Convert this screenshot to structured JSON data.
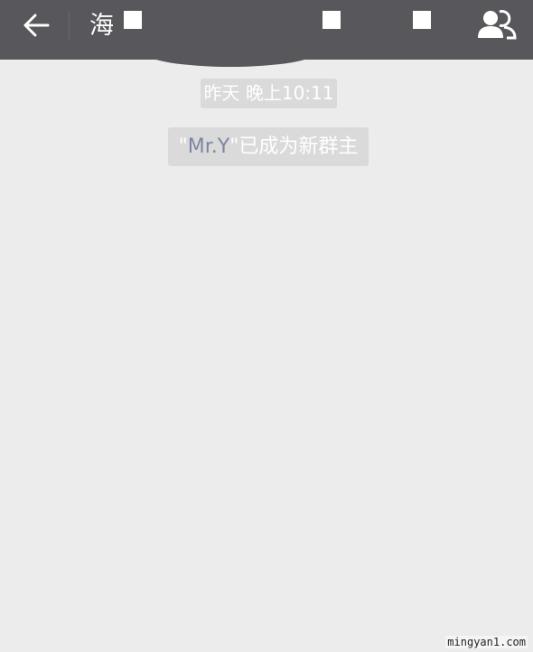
{
  "header": {
    "title": "海",
    "back_icon": "arrow-left-icon",
    "members_icon": "group-members-icon",
    "bg_color": "#58585c"
  },
  "chat": {
    "timestamp": "昨天 晚上10:11",
    "system_message": {
      "quote_open": "\"",
      "name": "Mr.Y",
      "quote_close": "\"",
      "text": "已成为新群主"
    }
  },
  "watermark": "mingyan1.com"
}
